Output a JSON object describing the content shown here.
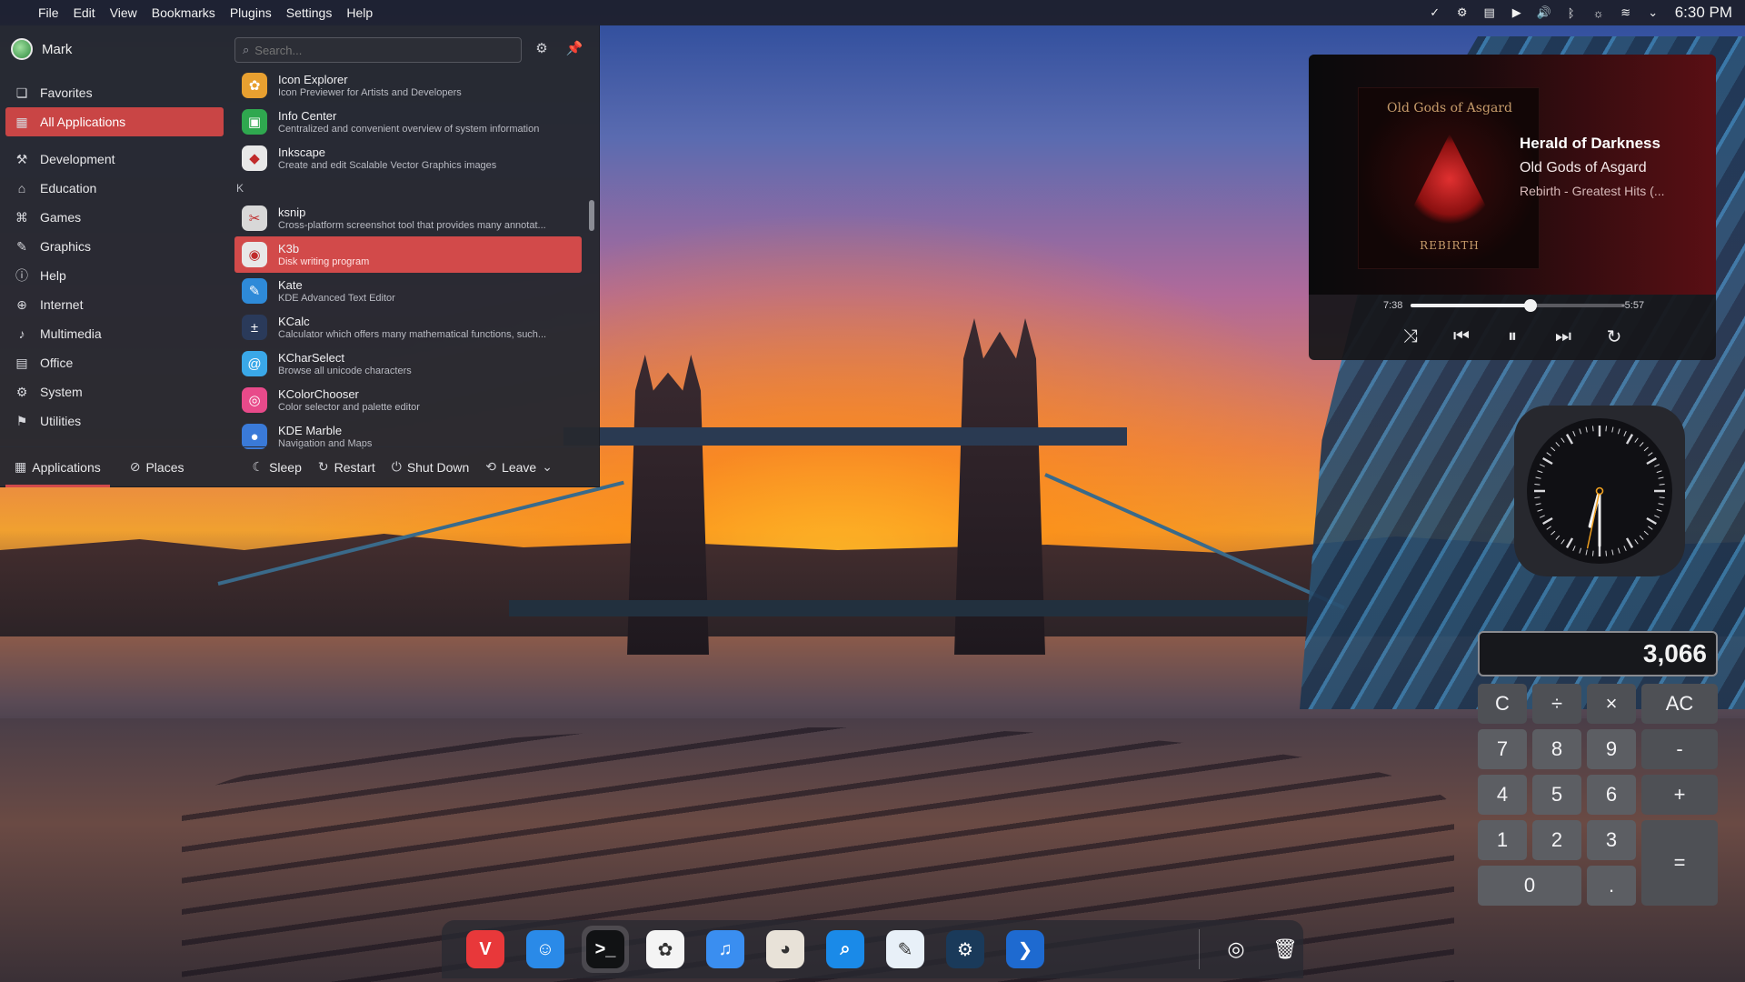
{
  "topbar": {
    "menu": [
      "File",
      "Edit",
      "View",
      "Bookmarks",
      "Plugins",
      "Settings",
      "Help"
    ],
    "time": "6:30 PM",
    "tray_icons": [
      "check-circle-icon",
      "steam-icon",
      "clipboard-icon",
      "media-play-icon",
      "volume-icon",
      "bluetooth-icon",
      "brightness-icon",
      "wifi-icon",
      "chevron-down-icon"
    ]
  },
  "launcher": {
    "user_name": "Mark",
    "search_placeholder": "Search...",
    "categories": [
      {
        "label": "Favorites",
        "icon": "bookmark-icon"
      },
      {
        "label": "All Applications",
        "icon": "grid-icon",
        "active": true
      },
      {
        "label": "Development",
        "icon": "hammer-icon"
      },
      {
        "label": "Education",
        "icon": "school-icon"
      },
      {
        "label": "Games",
        "icon": "gamepad-icon"
      },
      {
        "label": "Graphics",
        "icon": "palette-icon"
      },
      {
        "label": "Help",
        "icon": "info-icon"
      },
      {
        "label": "Internet",
        "icon": "globe-icon"
      },
      {
        "label": "Multimedia",
        "icon": "media-icon"
      },
      {
        "label": "Office",
        "icon": "document-icon"
      },
      {
        "label": "System",
        "icon": "gear-icon"
      },
      {
        "label": "Utilities",
        "icon": "tools-icon"
      }
    ],
    "apps_before": [
      {
        "name": "Icon Explorer",
        "desc": "Icon Previewer for Artists and Developers",
        "color": "#e8a030",
        "glyph": "✿"
      },
      {
        "name": "Info Center",
        "desc": "Centralized and convenient overview of system information",
        "color": "#2fa84f",
        "glyph": "▣"
      },
      {
        "name": "Inkscape",
        "desc": "Create and edit Scalable Vector Graphics images",
        "color": "#e8e8e8",
        "glyph": "◆"
      }
    ],
    "section_letter": "K",
    "apps_after": [
      {
        "name": "ksnip",
        "desc": "Cross-platform screenshot tool that provides many annotat...",
        "color": "#d8d8d8",
        "glyph": "✂"
      },
      {
        "name": "K3b",
        "desc": "Disk writing program",
        "color": "#e8e8e8",
        "glyph": "◉",
        "active": true
      },
      {
        "name": "Kate",
        "desc": "KDE Advanced Text Editor",
        "color": "#2e8ad8",
        "glyph": "✎"
      },
      {
        "name": "KCalc",
        "desc": "Calculator which offers many mathematical functions, such...",
        "color": "#2a3a5a",
        "glyph": "±"
      },
      {
        "name": "KCharSelect",
        "desc": "Browse all unicode characters",
        "color": "#3aa8e8",
        "glyph": "@"
      },
      {
        "name": "KColorChooser",
        "desc": "Color selector and palette editor",
        "color": "#e84a8a",
        "glyph": "◎"
      },
      {
        "name": "KDE Marble",
        "desc": "Navigation and Maps",
        "color": "#3a7ad8",
        "glyph": "●"
      }
    ],
    "footer": {
      "tabs": [
        "Applications",
        "Places"
      ],
      "actions": [
        {
          "label": "Sleep",
          "icon": "moon-icon"
        },
        {
          "label": "Restart",
          "icon": "restart-icon"
        },
        {
          "label": "Shut Down",
          "icon": "power-icon"
        },
        {
          "label": "Leave",
          "icon": "leave-icon"
        }
      ]
    }
  },
  "player": {
    "title": "Herald of Darkness",
    "artist": "Old Gods of Asgard",
    "album": "Rebirth - Greatest Hits (...",
    "album_art_text": "Old Gods of Asgard",
    "album_art_subtitle": "REBIRTH",
    "elapsed": "7:38",
    "remaining": "-5:57",
    "progress_fraction": 0.56
  },
  "clock": {
    "hour": 6,
    "minute": 30,
    "second": 32
  },
  "calculator": {
    "display": "3,066",
    "keys": [
      "C",
      "÷",
      "×",
      "AC",
      "7",
      "8",
      "9",
      "-",
      "4",
      "5",
      "6",
      "+",
      "1",
      "2",
      "3",
      "=",
      "0",
      "."
    ]
  },
  "dock": {
    "items": [
      {
        "name": "vivaldi-icon",
        "glyph": "V",
        "bg": "#e8383a"
      },
      {
        "name": "finder-icon",
        "glyph": "☺",
        "bg": "#2a8ae8"
      },
      {
        "name": "terminal-icon",
        "glyph": ">_",
        "bg": "#111214",
        "active": true
      },
      {
        "name": "photos-icon",
        "glyph": "✿",
        "bg": "#f4f4f4"
      },
      {
        "name": "music-icon",
        "glyph": "♫",
        "bg": "#3a8ef0"
      },
      {
        "name": "gimp-icon",
        "glyph": "◕",
        "bg": "#e8e2d8"
      },
      {
        "name": "search-app-icon",
        "glyph": "⌕",
        "bg": "#1a8ae8"
      },
      {
        "name": "preview-icon",
        "glyph": "✎",
        "bg": "#e8f0f8"
      },
      {
        "name": "steam-icon",
        "glyph": "⚙",
        "bg": "#1a3a5a"
      },
      {
        "name": "vscode-icon",
        "glyph": "❯",
        "bg": "#1e6ad0"
      }
    ],
    "right_items": [
      {
        "name": "screenshot-icon",
        "glyph": "◎"
      },
      {
        "name": "trash-icon",
        "glyph": "🗑"
      }
    ]
  }
}
